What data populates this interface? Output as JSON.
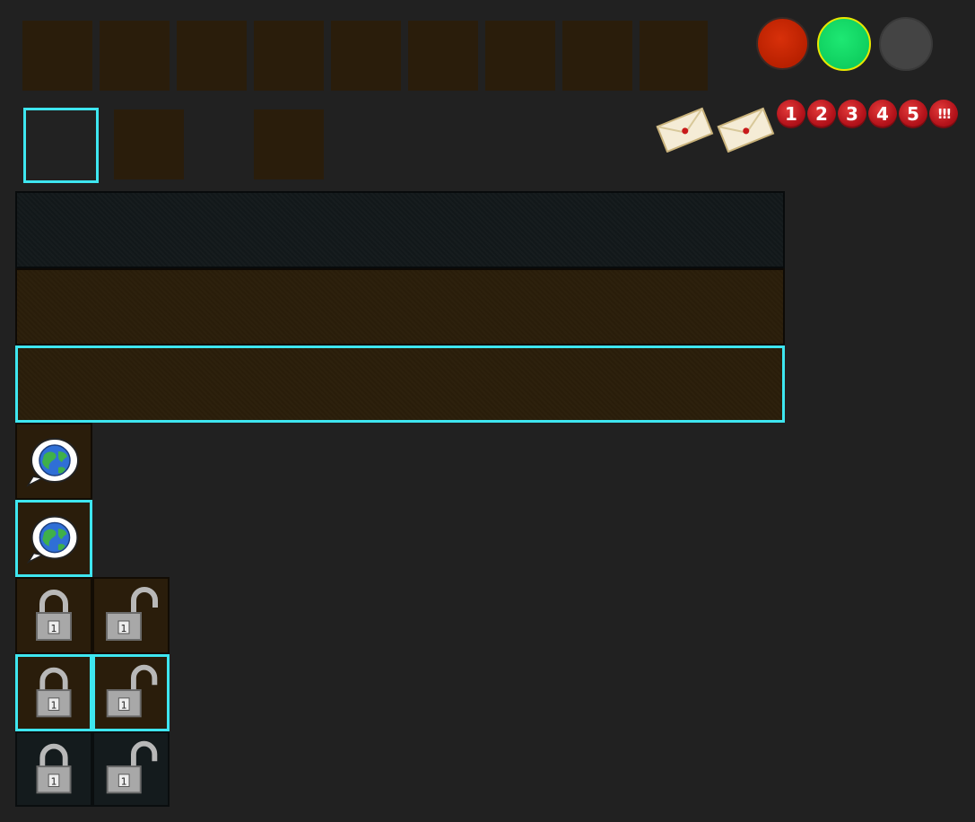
{
  "inventory": {
    "top_row_slots": 9,
    "second_row": [
      "selected-empty",
      "filled",
      "gap",
      "filled"
    ]
  },
  "status_lights": [
    {
      "name": "red",
      "color": "#cc2200"
    },
    {
      "name": "green",
      "color": "#11dd66",
      "ring": "#e8e800"
    },
    {
      "name": "grey",
      "color": "#444444"
    }
  ],
  "mail_icons": 2,
  "badges": [
    "1",
    "2",
    "3",
    "4",
    "5",
    "!!!"
  ],
  "colors": {
    "background": "#212121",
    "tile": "#2a1d0b",
    "selection": "#3ee6f0",
    "teal_panel": "#13191b",
    "badge_red": "#b3121a"
  },
  "panels": [
    "teal",
    "brown",
    "brown-selected"
  ],
  "chat_icons": 2,
  "lock_rows": [
    {
      "style": "brown",
      "selected": false
    },
    {
      "style": "brown",
      "selected": true
    },
    {
      "style": "teal",
      "selected": false
    }
  ],
  "lock_label": "1"
}
